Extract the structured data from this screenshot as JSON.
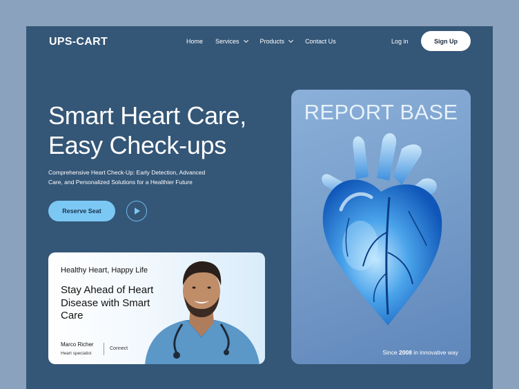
{
  "brand": "UPS-CART",
  "nav": {
    "items": [
      {
        "label": "Home",
        "has_dropdown": false
      },
      {
        "label": "Services",
        "has_dropdown": true
      },
      {
        "label": "Products",
        "has_dropdown": true
      },
      {
        "label": "Contact Us",
        "has_dropdown": false
      }
    ],
    "login": "Log in",
    "signup": "Sign Up"
  },
  "hero": {
    "title_line1": "Smart Heart Care,",
    "title_line2": "Easy Check-ups",
    "subtitle": "Comprehensive Heart Check-Up: Early Detection, Advanced Care, and Personalized Solutions for a Healthier Future",
    "cta": "Reserve Seat"
  },
  "card": {
    "eyebrow": "Healthy Heart, Happy Life",
    "title": "Stay Ahead of Heart Disease with Smart Care",
    "name": "Marco Richer",
    "role": "Heart specialist",
    "connect": "Connect"
  },
  "panel": {
    "title": "REPORT BASE",
    "foot_prefix": "Since",
    "foot_year": "2008",
    "foot_suffix": "in innovative way"
  },
  "colors": {
    "page_bg": "#8aa2bd",
    "frame_bg": "#345677",
    "accent": "#7cc8f4"
  },
  "icons": [
    "chevron-down-icon",
    "play-icon"
  ]
}
